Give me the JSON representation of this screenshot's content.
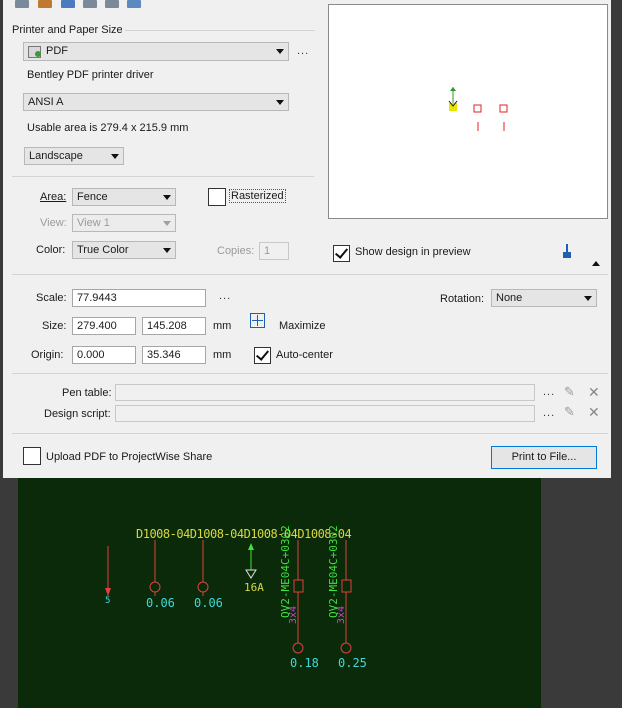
{
  "dialog": {
    "printer_group_label": "Printer and Paper Size",
    "printer": "PDF",
    "driver_text": "Bentley PDF printer driver",
    "paper_size": "ANSI A",
    "usable_area_text": "Usable area is 279.4 x 215.9 mm",
    "orientation": "Landscape",
    "area_label": "Area:",
    "area_value": "Fence",
    "view_label": "View:",
    "view_value": "View 1",
    "color_label": "Color:",
    "color_value": "True Color",
    "rasterized_label": "Rasterized",
    "copies_label": "Copies:",
    "copies_value": "1",
    "show_design_label": "Show design in preview",
    "scale_label": "Scale:",
    "scale_value": "77.9443",
    "rotation_label": "Rotation:",
    "rotation_value": "None",
    "size_label": "Size:",
    "size_x": "279.400",
    "size_y": "145.208",
    "size_unit": "mm",
    "maximize_label": "Maximize",
    "origin_label": "Origin:",
    "origin_x": "0.000",
    "origin_y": "35.346",
    "origin_unit": "mm",
    "autocenter_label": "Auto-center",
    "pen_table_label": "Pen table:",
    "pen_table_value": "",
    "design_script_label": "Design script:",
    "design_script_value": "",
    "upload_label": "Upload PDF to ProjectWise Share",
    "print_button": "Print to File...",
    "ellipsis": "..."
  },
  "cad": {
    "top_labels": "D1008-04D1008-04D1008-04D1008-04",
    "vertical_label_1": "QV2-ME04C+0302",
    "vertical_label_2": "QV2-ME04C+0302",
    "value_1": "0.06",
    "value_2": "0.06",
    "value_3": "16A",
    "value_4": "0.18",
    "value_5": "0.25",
    "small_label": "5",
    "sub_label_1": "3x4",
    "sub_label_2": "3x4"
  },
  "colors": {
    "cad_bg": "#0a2a0a",
    "cad_yellow": "#d8d840",
    "cad_red": "#e04040",
    "cad_cyan": "#40d8d8",
    "cad_magenta": "#d040d0",
    "cad_green": "#40e040",
    "accent": "#0078d7"
  }
}
